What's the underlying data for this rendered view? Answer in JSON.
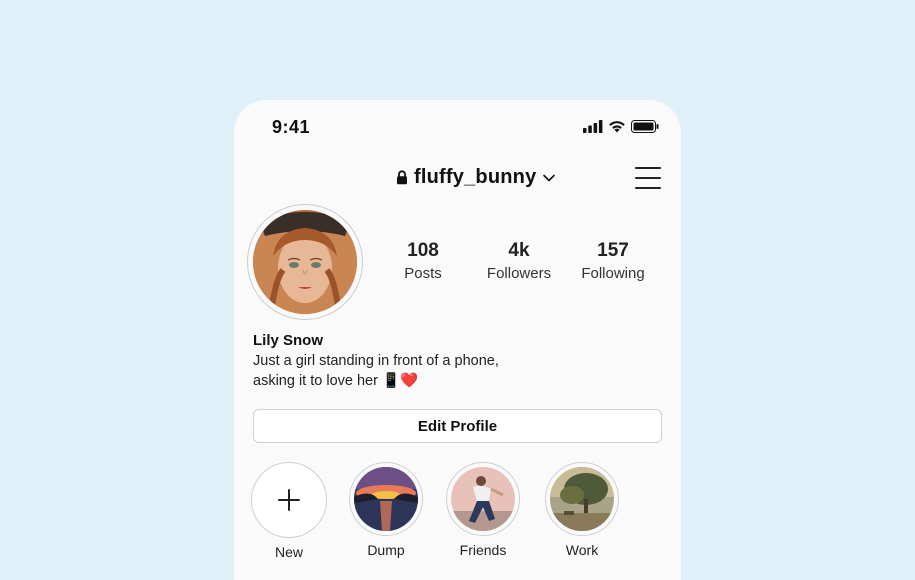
{
  "status_bar": {
    "time": "9:41",
    "icons": [
      "signal-icon",
      "wifi-icon",
      "battery-icon"
    ]
  },
  "header": {
    "username": "fluffy_bunny",
    "lock_icon": "lock-icon",
    "dropdown_icon": "chevron-down-icon",
    "menu_icon": "hamburger-menu-icon"
  },
  "stats": [
    {
      "value": "108",
      "label": "Posts"
    },
    {
      "value": "4k",
      "label": "Followers"
    },
    {
      "value": "157",
      "label": "Following"
    }
  ],
  "bio": {
    "name": "Lily Snow",
    "line1": "Just a girl standing in front of a phone,",
    "line2": "asking it to love her 📱❤️"
  },
  "edit_profile_label": "Edit Profile",
  "highlights": [
    {
      "label": "New",
      "icon": "plus-icon"
    },
    {
      "label": "Dump"
    },
    {
      "label": "Friends"
    },
    {
      "label": "Work"
    }
  ],
  "colors": {
    "background": "#dff0f8",
    "phone": "#fafafa",
    "text": "#111111"
  }
}
